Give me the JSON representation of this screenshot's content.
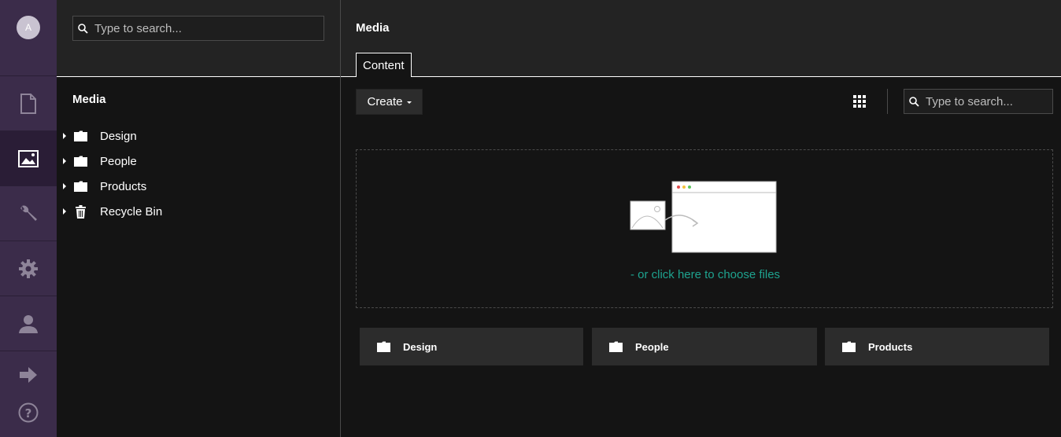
{
  "user": {
    "avatar_initial": "A"
  },
  "nav": {
    "items": [
      {
        "icon": "document-icon"
      },
      {
        "icon": "media-image-icon",
        "active": true
      },
      {
        "icon": "wrench-icon"
      },
      {
        "icon": "gear-icon"
      },
      {
        "icon": "user-icon"
      }
    ],
    "bottom": [
      {
        "icon": "arrow-right-icon"
      },
      {
        "icon": "help-icon"
      }
    ]
  },
  "tree": {
    "search_placeholder": "Type to search...",
    "title": "Media",
    "items": [
      {
        "label": "Design",
        "icon": "folder-icon"
      },
      {
        "label": "People",
        "icon": "folder-icon"
      },
      {
        "label": "Products",
        "icon": "folder-icon"
      },
      {
        "label": "Recycle Bin",
        "icon": "trash-icon"
      }
    ]
  },
  "main": {
    "title": "Media",
    "tab": "Content",
    "create_label": "Create",
    "search_placeholder": "Type to search...",
    "dropzone_text": "- or click here to choose files",
    "folders": [
      {
        "label": "Design"
      },
      {
        "label": "People"
      },
      {
        "label": "Products"
      }
    ]
  },
  "colors": {
    "nav_bg": "#3b2c4a",
    "accent_link": "#1ea38f"
  }
}
